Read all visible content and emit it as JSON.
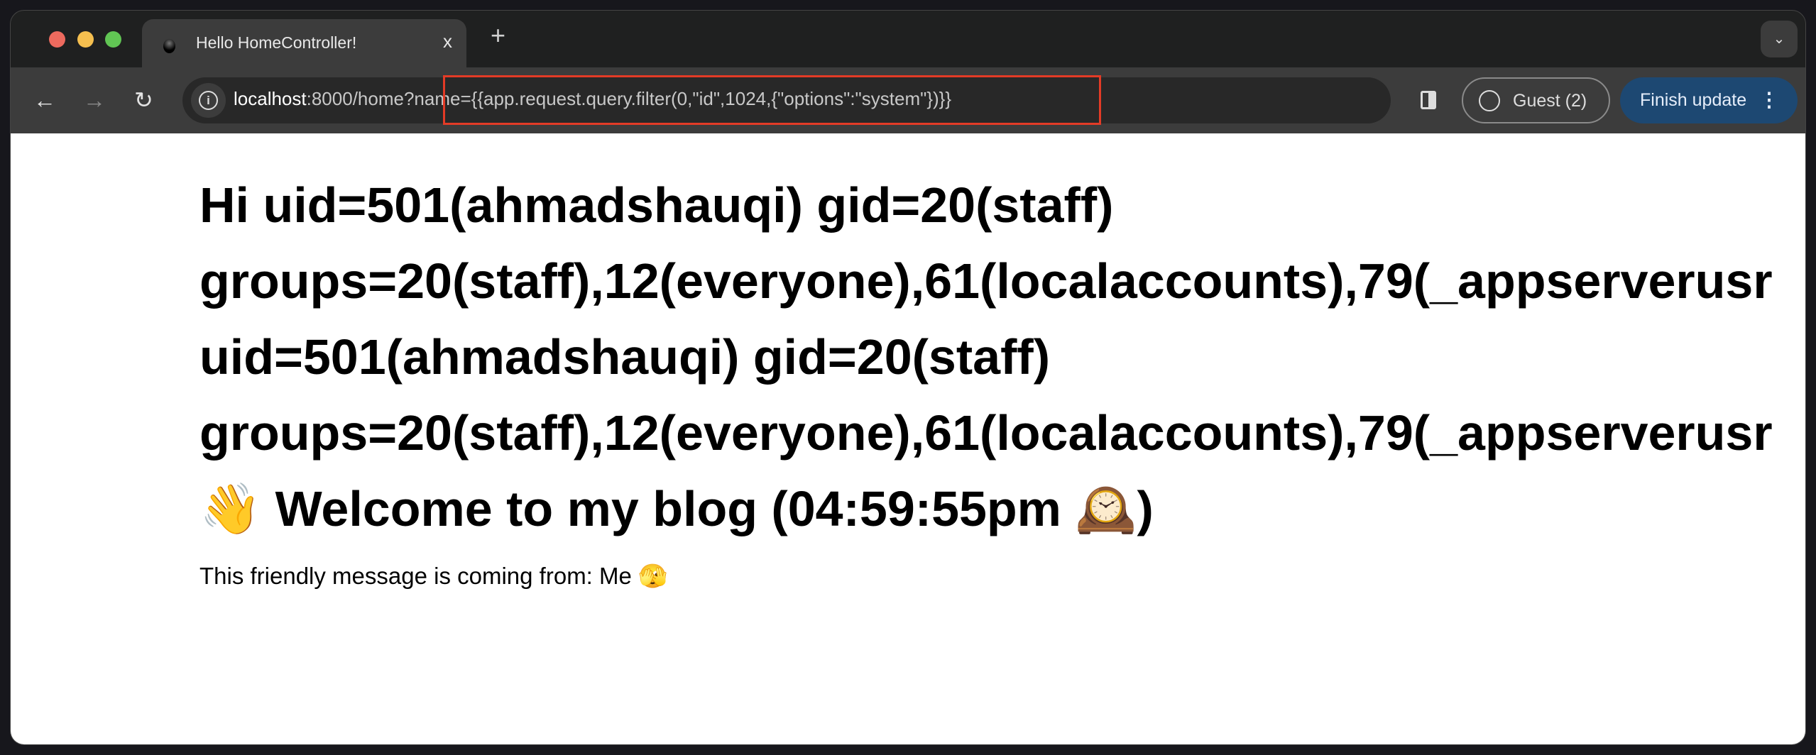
{
  "window": {
    "traffic_lights": {
      "close": "#ed6a5e",
      "minimize": "#f5bf4f",
      "maximize": "#61c554"
    }
  },
  "tab": {
    "title": "Hello HomeController!",
    "close_label": "x",
    "new_tab_label": "+",
    "dropdown_label": "⌄"
  },
  "toolbar": {
    "back_icon": "←",
    "forward_icon": "→",
    "reload_icon": "↻",
    "url_host": "localhost",
    "url_rest": ":8000/home?",
    "url_query": "name={{app.request.query.filter(0,\"id\",1024,{\"options\":\"system\"})}}",
    "highlight_color": "#e33b26",
    "guest_label": "Guest (2)",
    "finish_update_label": "Finish update",
    "menu_icon": "⋮"
  },
  "page": {
    "greeting_lines": [
      "Hi uid=501(ahmadshauqi) gid=20(staff)",
      "groups=20(staff),12(everyone),61(localaccounts),79(_appserverusr",
      "uid=501(ahmadshauqi) gid=20(staff)",
      "groups=20(staff),12(everyone),61(localaccounts),79(_appserverusr"
    ],
    "welcome": "👋 Welcome to my blog (04:59:55pm 🕰️)",
    "message": "This friendly message is coming from: Me 🫣"
  }
}
